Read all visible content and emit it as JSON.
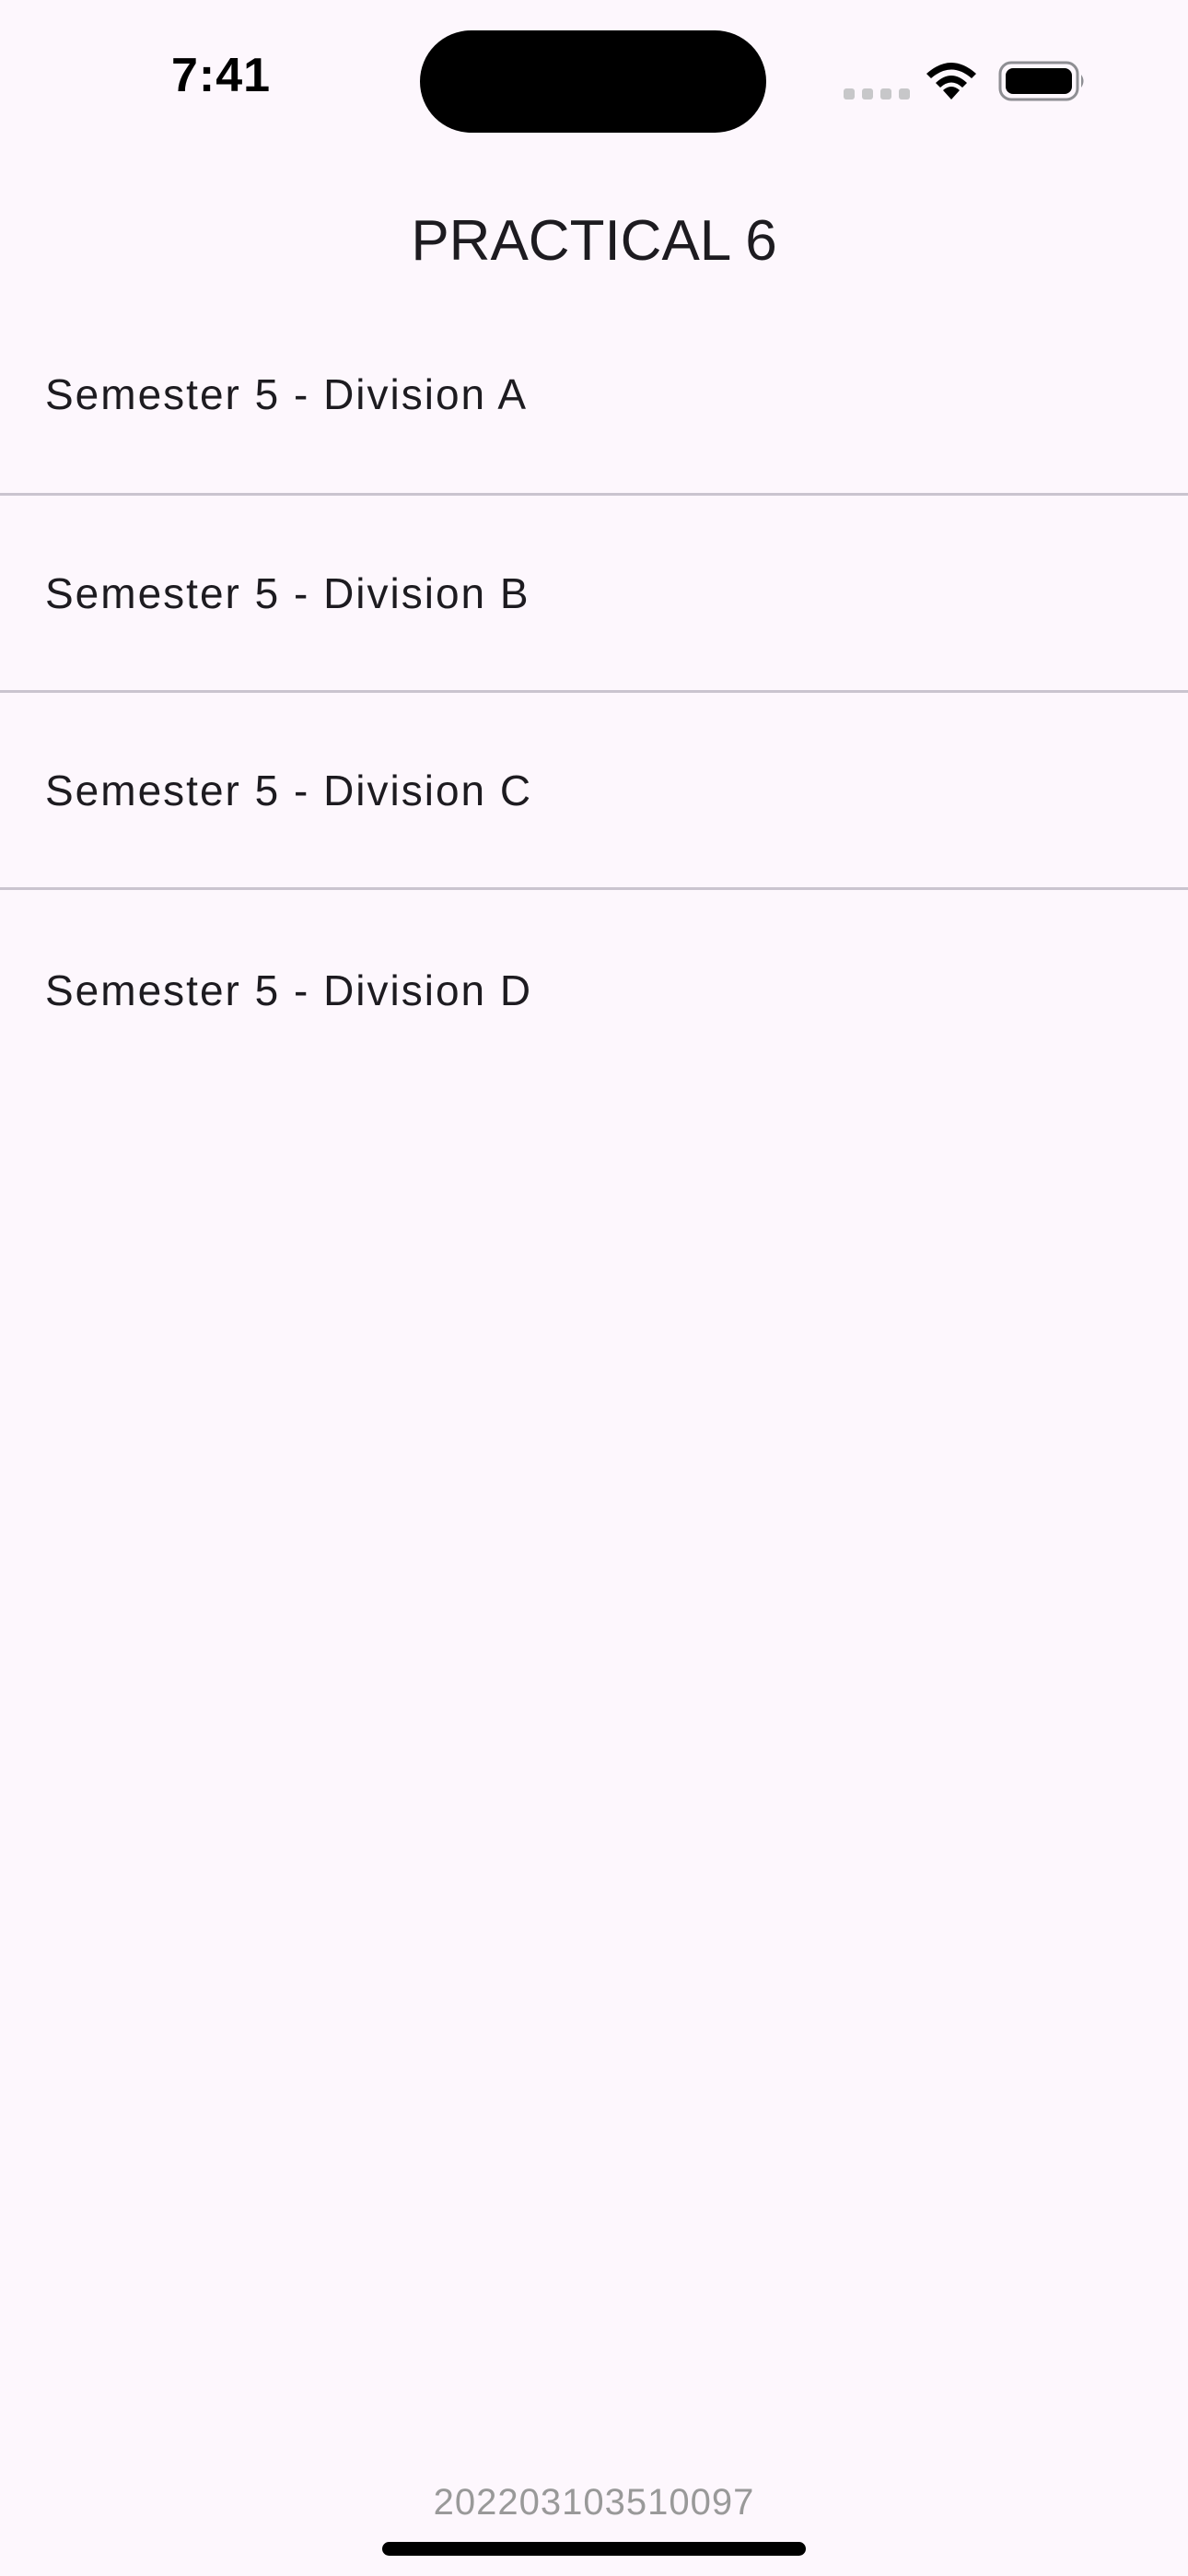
{
  "status_bar": {
    "time": "7:41",
    "icons": [
      "cellular-signal-icon",
      "wifi-icon",
      "battery-icon"
    ]
  },
  "app_bar": {
    "title": "PRACTICAL 6"
  },
  "list": {
    "items": [
      {
        "label": "Semester 5 - Division A"
      },
      {
        "label": "Semester 5 - Division B"
      },
      {
        "label": "Semester 5 - Division C"
      },
      {
        "label": "Semester 5 - Division D"
      }
    ]
  },
  "footer": {
    "id_text": "202203103510097"
  },
  "colors": {
    "background": "#fdf7fd",
    "text": "#1d1b20",
    "divider": "#cac4cf",
    "footer_text": "#999999"
  }
}
